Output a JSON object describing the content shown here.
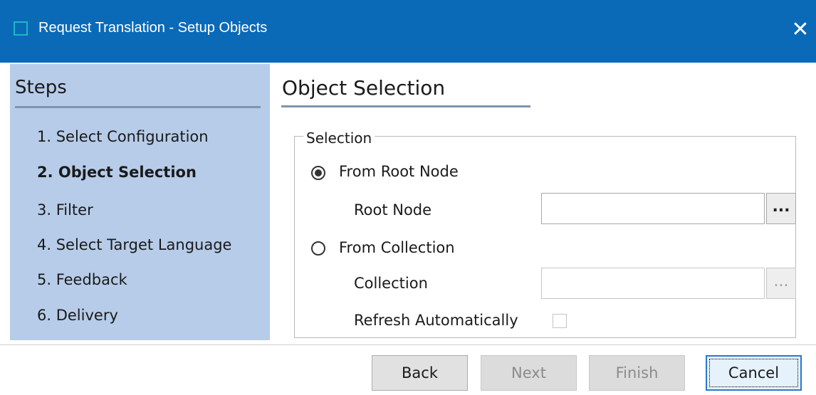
{
  "window": {
    "title": "Request Translation - Setup Objects",
    "close_glyph": "✕",
    "icon": "window-icon"
  },
  "steps": {
    "title": "Steps",
    "items": [
      {
        "label": "1. Select Configuration",
        "active": false
      },
      {
        "label": "2. Object Selection",
        "active": true
      },
      {
        "label": "3. Filter",
        "active": false
      },
      {
        "label": "4. Select Target Language",
        "active": false
      },
      {
        "label": "5. Feedback",
        "active": false
      },
      {
        "label": "6. Delivery",
        "active": false
      }
    ]
  },
  "content": {
    "title": "Object Selection",
    "group": {
      "legend": "Selection",
      "from_root_node": {
        "label": "From Root Node",
        "selected": true
      },
      "root_node": {
        "label": "Root Node",
        "value": "",
        "browse_label": "..."
      },
      "from_collection": {
        "label": "From Collection",
        "selected": false
      },
      "collection": {
        "label": "Collection",
        "value": "",
        "browse_label": "...",
        "enabled": false
      },
      "refresh_automatically": {
        "label": "Refresh Automatically",
        "checked": false
      }
    }
  },
  "buttons": {
    "back": {
      "label": "Back",
      "enabled": true
    },
    "next": {
      "label": "Next",
      "enabled": false
    },
    "finish": {
      "label": "Finish",
      "enabled": false
    },
    "cancel": {
      "label": "Cancel",
      "enabled": true,
      "focused": true
    }
  },
  "colors": {
    "titlebar": "#0a6ab8",
    "steps_panel": "#b7cce9",
    "divider": "#7e94ab"
  }
}
